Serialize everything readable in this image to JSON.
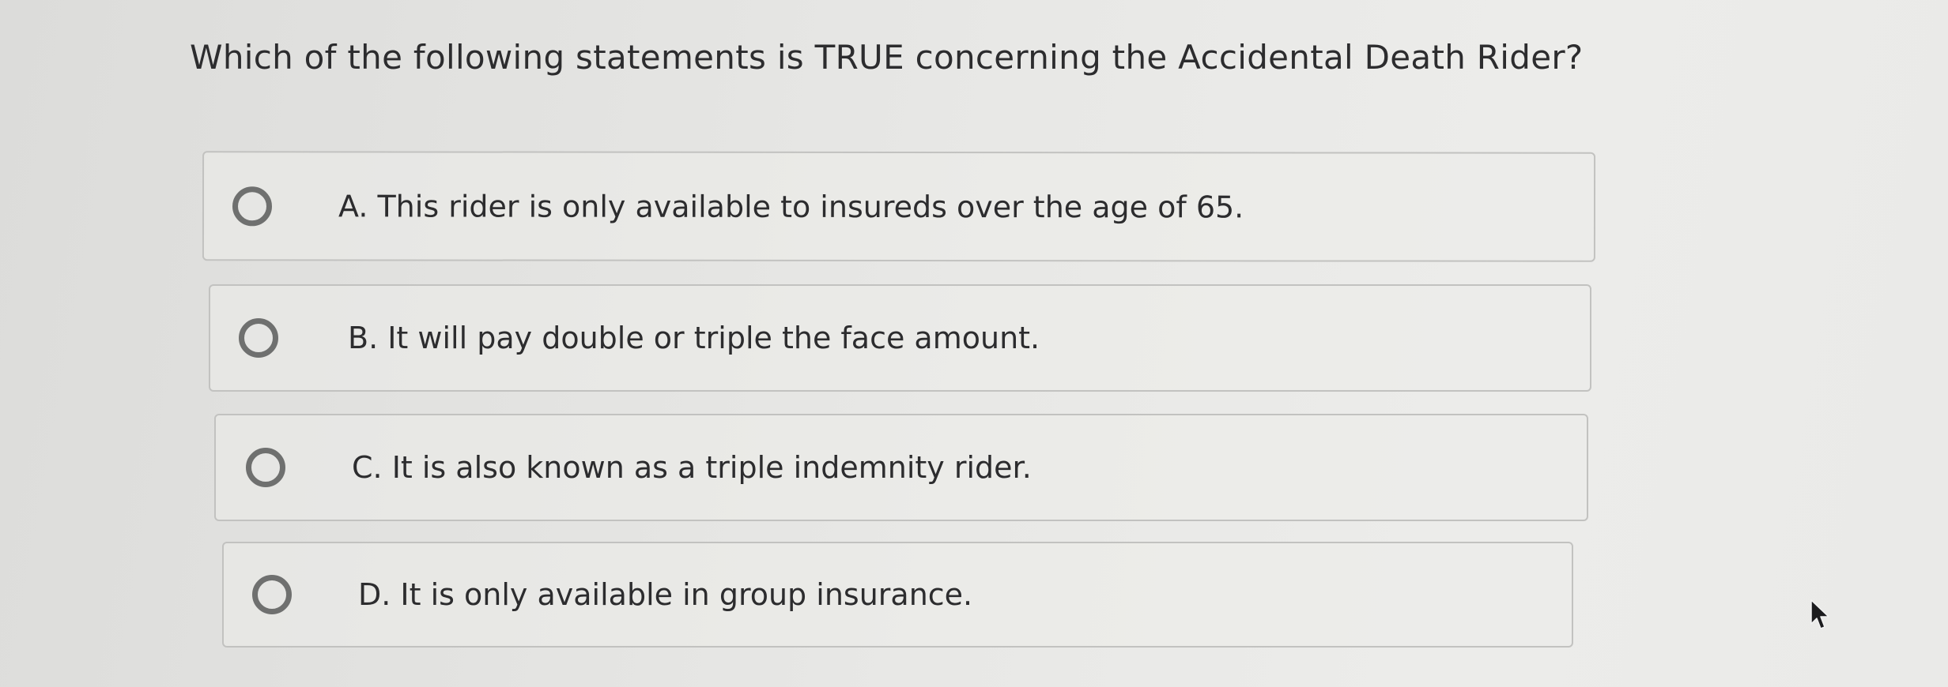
{
  "question": {
    "text": "Which of the following statements is TRUE concerning the Accidental Death Rider?"
  },
  "options": [
    {
      "text": "A. This rider is only available to insureds over the age of 65."
    },
    {
      "text": "B. It will pay double or triple the face amount."
    },
    {
      "text": "C. It is also known as a triple indemnity rider."
    },
    {
      "text": "D. It is only available in group insurance."
    }
  ],
  "colors": {
    "text": "#2c2c2e",
    "radio_border": "#6f706f",
    "option_border": "#c2c2c0",
    "background": "#e4e4e2"
  },
  "icons": {
    "radio": "radio-button-icon",
    "cursor": "mouse-pointer-icon"
  }
}
